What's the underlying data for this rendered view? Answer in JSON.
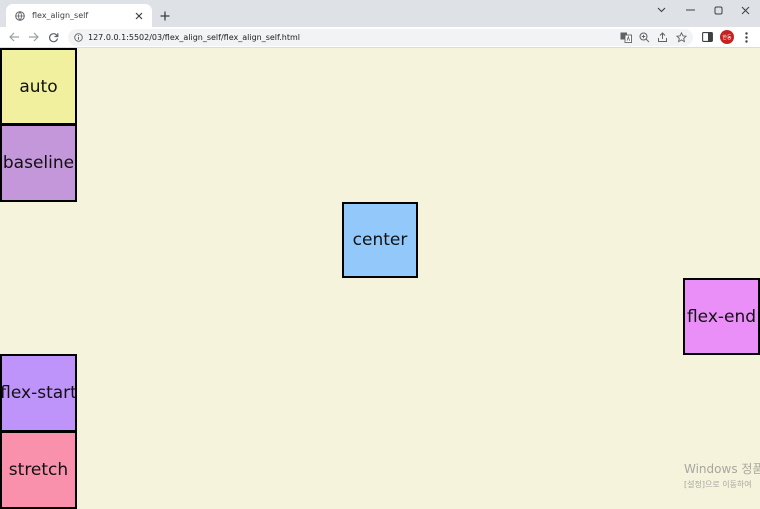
{
  "browser": {
    "tab_title": "flex_align_self",
    "url": "127.0.0.1:5502/03/flex_align_self/flex_align_self.html",
    "avatar_initials": "한동"
  },
  "icons": {
    "favicon": "globe-icon",
    "tab_close": "close-icon",
    "new_tab": "plus-icon",
    "back": "arrow-left-icon",
    "forward": "arrow-right-icon",
    "reload": "reload-icon",
    "site_info": "info-icon",
    "translate": "translate-icon",
    "zoom": "zoom-icon",
    "share": "share-icon",
    "bookmark": "star-icon",
    "side_panel": "side-panel-icon",
    "menu": "kebab-menu-icon"
  },
  "boxes": [
    {
      "label": "auto",
      "color": "#f0f09e"
    },
    {
      "label": "baseline",
      "color": "#c497da"
    },
    {
      "label": "center",
      "color": "#93c9fa"
    },
    {
      "label": "flex-end",
      "color": "#e98ff7"
    },
    {
      "label": "flex-start",
      "color": "#be93fa"
    },
    {
      "label": "stretch",
      "color": "#f991ad"
    }
  ],
  "watermark": {
    "line1": "Windows 정품",
    "line2": "[설정]으로 이동하여"
  }
}
